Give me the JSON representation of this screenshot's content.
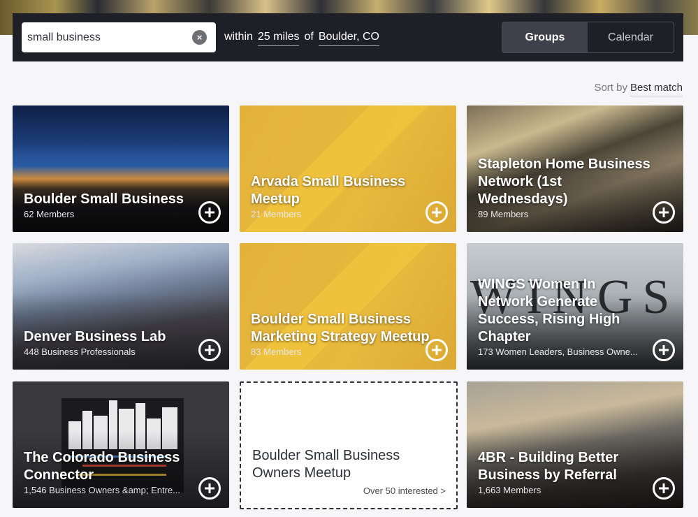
{
  "search": {
    "query": "small business",
    "within_label": "within",
    "distance": "25 miles",
    "of_label": "of",
    "location": "Boulder, CO"
  },
  "view_toggle": {
    "groups": "Groups",
    "calendar": "Calendar",
    "active": "Groups"
  },
  "sort": {
    "label": "Sort by",
    "value": "Best match"
  },
  "cards": [
    {
      "title": "Boulder Small Business",
      "members": "62 Members"
    },
    {
      "title": "Arvada Small Business Meetup",
      "members": "21 Members"
    },
    {
      "title": "Stapleton Home Business Network (1st Wednesdays)",
      "members": "89 Members"
    },
    {
      "title": "Denver Business Lab",
      "members": "448 Business Professionals"
    },
    {
      "title": "Boulder Small Business Marketing Strategy Meetup",
      "members": "83 Members"
    },
    {
      "title": "WINGS Women In Network Generate Success, Rising High Chapter",
      "members": "173 Women Leaders, Business Owne..."
    },
    {
      "title": "The Colorado Business Connector",
      "members": "1,546 Business Owners &amp; Entre..."
    },
    {
      "title": "Boulder Small Business Owners Meetup",
      "interested": "Over 50 interested >"
    },
    {
      "title": "4BR - Building Better Business by Referral",
      "members": "1,663 Members"
    }
  ],
  "wings_logo_text": "WINGS",
  "colors": {
    "bar_bg": "#1f2027",
    "accent_yellow": "#e4b23a",
    "page_bg": "#f6f6f8"
  },
  "icons": [
    "clear-icon",
    "plus-circle-icon"
  ]
}
